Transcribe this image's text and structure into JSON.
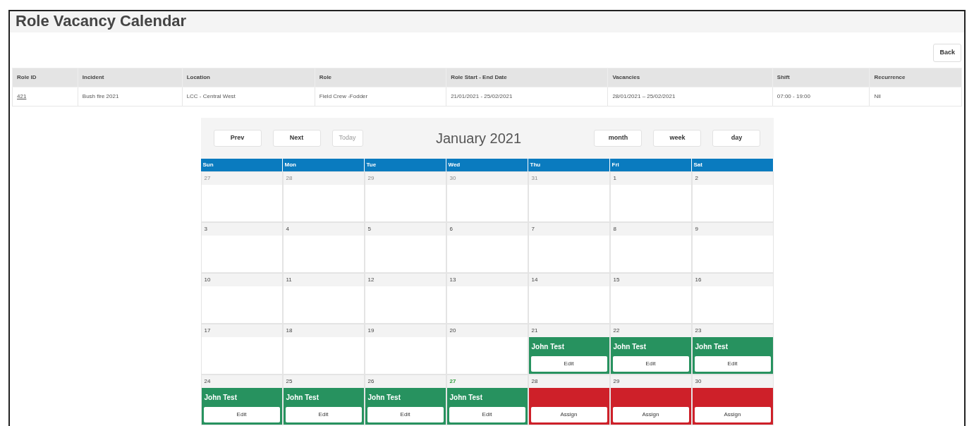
{
  "page_title": "Role Vacancy Calendar",
  "back_button": "Back",
  "role_table": {
    "columns": [
      "Role ID",
      "Incident",
      "Location",
      "Role",
      "Role Start - End Date",
      "Vacancies",
      "Shift",
      "Recurrence"
    ],
    "rows": [
      [
        "421",
        "Bush fire 2021",
        "LCC - Central West",
        "Field Crew  -Fodder",
        "21/01/2021 - 25/02/2021",
        "28/01/2021 – 25/02/2021",
        "07:00 - 19:00",
        "Nil"
      ]
    ]
  },
  "calendar": {
    "title": "January 2021",
    "nav_buttons": [
      {
        "label": "Prev",
        "disabled": false
      },
      {
        "label": "Next",
        "disabled": false
      },
      {
        "label": "Today",
        "disabled": true
      }
    ],
    "view_buttons": [
      {
        "label": "month",
        "selected": false
      },
      {
        "label": "week",
        "selected": false
      },
      {
        "label": "day",
        "selected": false
      }
    ],
    "weekdays": [
      "Sun",
      "Mon",
      "Tue",
      "Wed",
      "Thu",
      "Fri",
      "Sat"
    ],
    "weeks": [
      [
        {
          "date": "27",
          "other_month": true
        },
        {
          "date": "28",
          "other_month": true
        },
        {
          "date": "29",
          "other_month": true
        },
        {
          "date": "30",
          "other_month": true
        },
        {
          "date": "31",
          "other_month": true
        },
        {
          "date": "1",
          "other_month": false
        },
        {
          "date": "2",
          "other_month": false
        }
      ],
      [
        {
          "date": "3",
          "other_month": false
        },
        {
          "date": "4",
          "other_month": false
        },
        {
          "date": "5",
          "other_month": false
        },
        {
          "date": "6",
          "other_month": false
        },
        {
          "date": "7",
          "other_month": false
        },
        {
          "date": "8",
          "other_month": false
        },
        {
          "date": "9",
          "other_month": false
        }
      ],
      [
        {
          "date": "10",
          "other_month": false
        },
        {
          "date": "11",
          "other_month": false
        },
        {
          "date": "12",
          "other_month": false
        },
        {
          "date": "13",
          "other_month": false
        },
        {
          "date": "14",
          "other_month": false
        },
        {
          "date": "15",
          "other_month": false
        },
        {
          "date": "16",
          "other_month": false
        }
      ],
      [
        {
          "date": "17",
          "other_month": false
        },
        {
          "date": "18",
          "other_month": false
        },
        {
          "date": "19",
          "other_month": false
        },
        {
          "date": "20",
          "other_month": false
        },
        {
          "date": "21",
          "other_month": false,
          "event": {
            "kind": "filled",
            "name": "John Test",
            "button": "Edit"
          }
        },
        {
          "date": "22",
          "other_month": false,
          "event": {
            "kind": "filled",
            "name": "John Test",
            "button": "Edit"
          }
        },
        {
          "date": "23",
          "other_month": false,
          "event": {
            "kind": "filled",
            "name": "John Test",
            "button": "Edit"
          }
        }
      ],
      [
        {
          "date": "24",
          "other_month": false,
          "event": {
            "kind": "filled",
            "name": "John Test",
            "button": "Edit"
          }
        },
        {
          "date": "25",
          "other_month": false,
          "event": {
            "kind": "filled",
            "name": "John Test",
            "button": "Edit"
          }
        },
        {
          "date": "26",
          "other_month": false,
          "event": {
            "kind": "filled",
            "name": "John Test",
            "button": "Edit"
          }
        },
        {
          "date": "27",
          "other_month": false,
          "today": true,
          "event": {
            "kind": "filled",
            "name": "John Test",
            "button": "Edit"
          }
        },
        {
          "date": "28",
          "other_month": false,
          "event": {
            "kind": "vacant",
            "button": "Assign"
          }
        },
        {
          "date": "29",
          "other_month": false,
          "event": {
            "kind": "vacant",
            "button": "Assign"
          }
        },
        {
          "date": "30",
          "other_month": false,
          "event": {
            "kind": "vacant",
            "button": "Assign"
          }
        }
      ]
    ]
  }
}
